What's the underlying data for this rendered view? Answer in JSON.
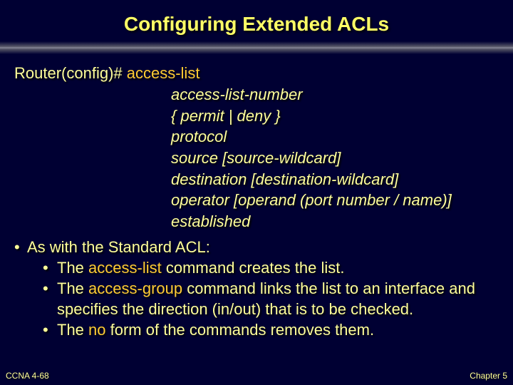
{
  "slide": {
    "title": "Configuring Extended ACLs",
    "prompt_prefix": "Router(config)# ",
    "prompt_command": "access-list",
    "syntax": [
      "access-list-number",
      "{ permit | deny }",
      "protocol",
      "source [source-wildcard]",
      "destination [destination-wildcard]",
      "operator [operand (port number / name)]",
      "established"
    ],
    "bullet_main": "As with the Standard ACL:",
    "sub1_pre": "The ",
    "sub1_hl": "access-list",
    "sub1_post": " command creates the list.",
    "sub2_pre": "The ",
    "sub2_hl": "access-group",
    "sub2_post": " command links the list to an interface and specifies the direction (in/out) that is to be checked.",
    "sub3_pre": "The ",
    "sub3_hl": "no",
    "sub3_post": " form of the commands removes them.",
    "footer_left": "CCNA 4-68",
    "footer_right": "Chapter 5"
  }
}
